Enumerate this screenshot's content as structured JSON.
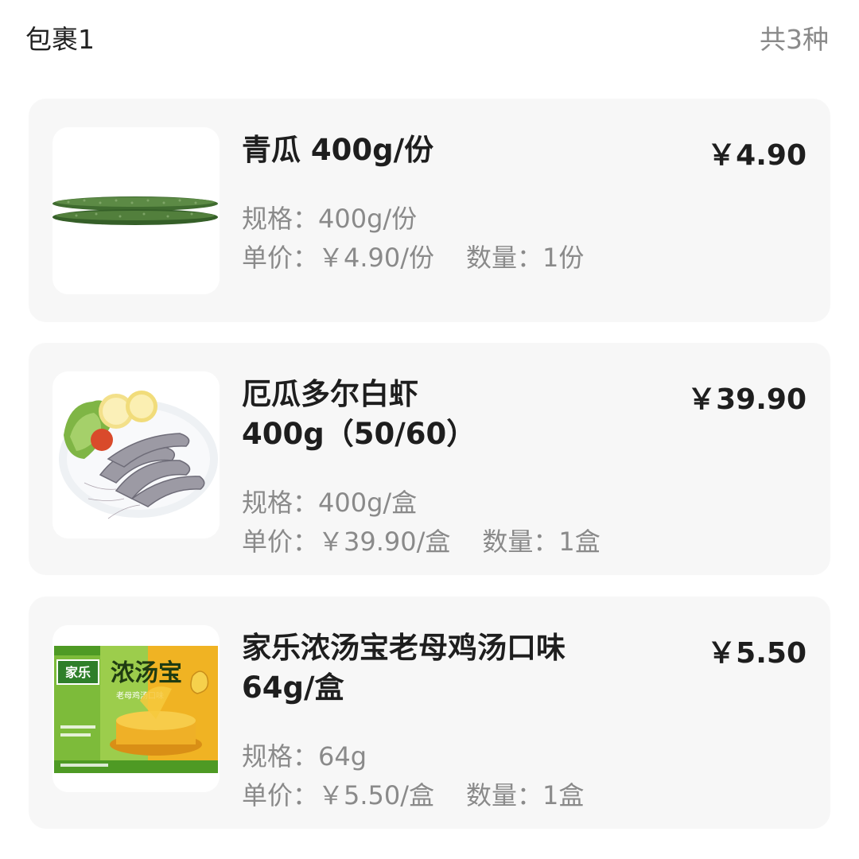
{
  "package": {
    "title": "包裹1",
    "count": "共3种"
  },
  "items": [
    {
      "name_line1": "青瓜 400g/份",
      "name_line2": "",
      "price": "￥4.90",
      "spec": "规格：400g/份",
      "unit_price": "单价：￥4.90/份",
      "quantity": "数量：1份",
      "image": "cucumber-image"
    },
    {
      "name_line1": "厄瓜多尔白虾",
      "name_line2": "400g（50/60）",
      "price": "￥39.90",
      "spec": "规格：400g/盒",
      "unit_price": "单价：￥39.90/盒",
      "quantity": "数量：1盒",
      "image": "shrimp-plate-image"
    },
    {
      "name_line1": "家乐浓汤宝老母鸡汤口味",
      "name_line2": "64g/盒",
      "price": "￥5.50",
      "spec": "规格：64g",
      "unit_price": "单价：￥5.50/盒",
      "quantity": "数量：1盒",
      "image": "soup-stock-box-image",
      "image_text": {
        "brand": "家乐",
        "product": "浓汤宝",
        "flavor": "老母鸡汤口味"
      }
    }
  ],
  "colors": {
    "card_background": "#f7f7f7",
    "secondary_text": "#8a8a8a",
    "primary_text": "#1e1e1e"
  }
}
